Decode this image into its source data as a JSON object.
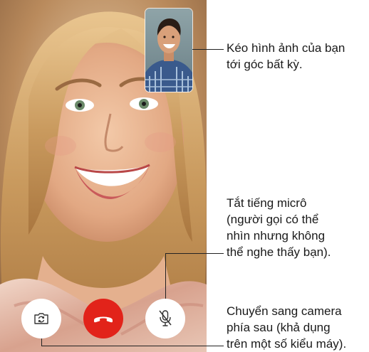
{
  "callouts": {
    "drag_text": "Kéo hình ảnh của bạn\ntới góc bất kỳ.",
    "mute_text": "Tắt tiếng micrô\n(người gọi có thể\nnhìn nhưng không\nthể nghe thấy bạn).",
    "switch_text": "Chuyển sang camera\nphía sau (khả dụng\ntrên một số kiểu máy)."
  },
  "controls": {
    "flip_camera_icon": "camera-flip-icon",
    "end_call_icon": "phone-hangup-icon",
    "mute_icon": "microphone-muted-icon"
  },
  "colors": {
    "end_call": "#e2231a",
    "control_bg": "#ffffff",
    "callout_line": "#222222"
  }
}
